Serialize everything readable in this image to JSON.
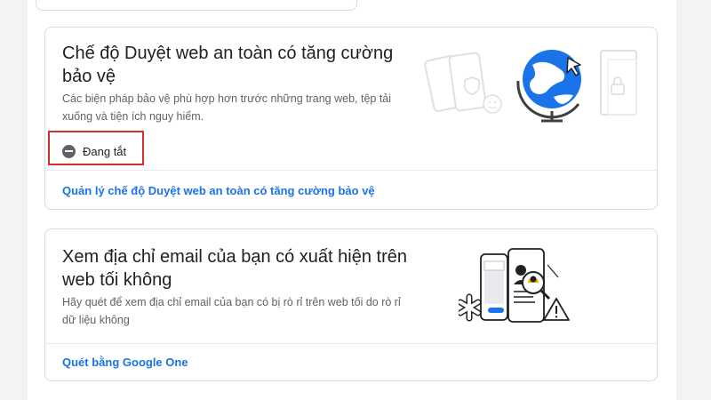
{
  "safe_browsing": {
    "title": "Chế độ Duyệt web an toàn có tăng cường bảo vệ",
    "description": "Các biện pháp bảo vệ phù hợp hơn trước những trang web, tệp tải xuống và tiện ích nguy hiểm.",
    "status_label": "Đang tắt",
    "status_icon": "minus-circle-icon",
    "link_label": "Quản lý chế độ Duyệt web an toàn có tăng cường bảo vệ"
  },
  "email_check": {
    "title": "Xem địa chỉ email của bạn có xuất hiện trên web tối không",
    "description": "Hãy quét để xem địa chỉ email của bạn có bị rò rỉ trên web tối do rò rỉ dữ liệu không",
    "link_label": "Quét bằng Google One"
  },
  "colors": {
    "link": "#1a73e8",
    "highlight": "#d32f2f",
    "text_primary": "#202124",
    "text_secondary": "#5f6368"
  }
}
